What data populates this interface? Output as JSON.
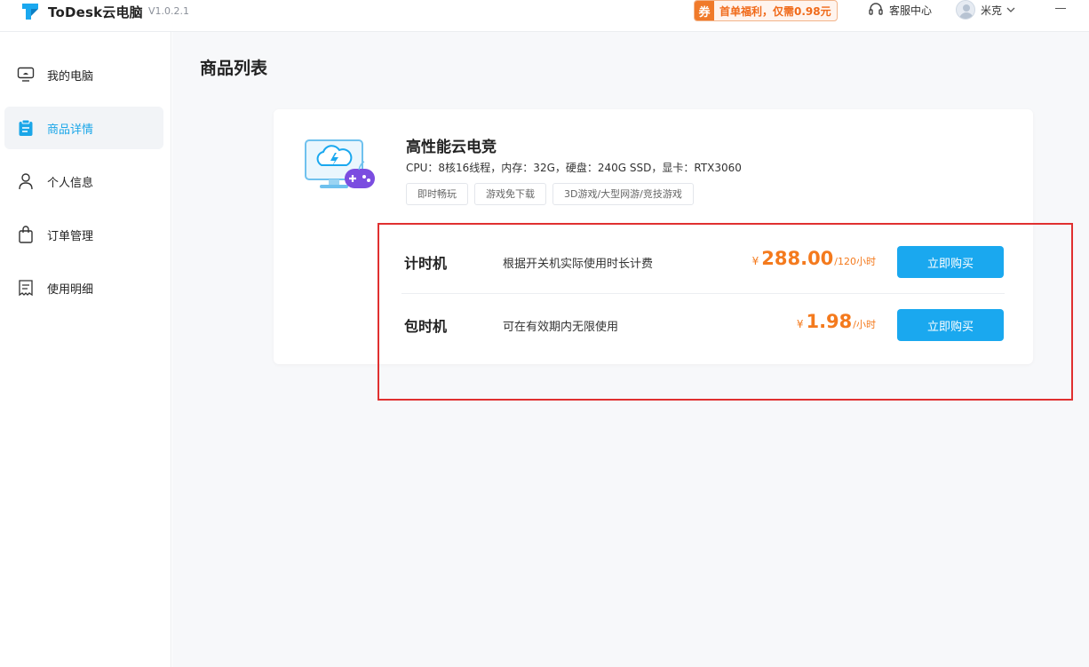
{
  "titlebar": {
    "app_name": "ToDesk云电脑",
    "version": "V1.0.2.1",
    "promo_badge": "券",
    "promo_text": "首单福利，仅需0.98元",
    "support": "客服中心",
    "username": "米克"
  },
  "sidebar": {
    "items": [
      {
        "label": "我的电脑",
        "icon": "monitor-icon"
      },
      {
        "label": "商品详情",
        "icon": "clipboard-icon"
      },
      {
        "label": "个人信息",
        "icon": "person-icon"
      },
      {
        "label": "订单管理",
        "icon": "shopping-bag-icon"
      },
      {
        "label": "使用明细",
        "icon": "receipt-icon"
      }
    ],
    "active_index": 1
  },
  "main": {
    "page_title": "商品列表",
    "product": {
      "name": "高性能云电竞",
      "specs": "CPU：8核16线程，内存：32G，硬盘：240G SSD，显卡：RTX3060",
      "tags": [
        "即时畅玩",
        "游戏免下载",
        "3D游戏/大型网游/竞技游戏"
      ],
      "plans": [
        {
          "name": "计时机",
          "desc": "根据开关机实际使用时长计费",
          "currency": "¥",
          "price": "288.00",
          "unit": "/120小时",
          "button": "立即购买"
        },
        {
          "name": "包时机",
          "desc": "可在有效期内无限使用",
          "currency": "¥",
          "price": "1.98",
          "unit": "/小时",
          "button": "立即购买"
        }
      ]
    }
  },
  "colors": {
    "accent": "#1aa8ef",
    "price": "#f47a1d",
    "annotation_box": "#e03030"
  }
}
